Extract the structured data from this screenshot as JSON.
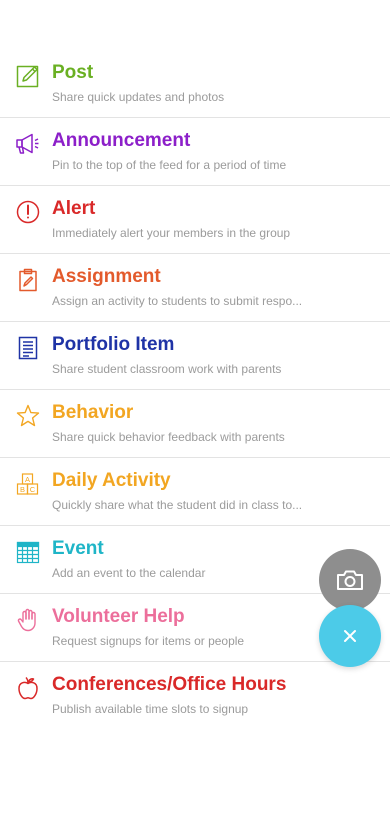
{
  "menu": {
    "items": [
      {
        "title": "Post",
        "subtitle": "Share quick updates and photos",
        "icon": "pencil-square-icon",
        "color": "#6ab023"
      },
      {
        "title": "Announcement",
        "subtitle": "Pin to the top of the feed for a period of time",
        "icon": "megaphone-icon",
        "color": "#8c1fc9"
      },
      {
        "title": "Alert",
        "subtitle": "Immediately alert your members in the group",
        "icon": "exclamation-circle-icon",
        "color": "#d92929"
      },
      {
        "title": "Assignment",
        "subtitle": "Assign an activity to students to submit respo...",
        "icon": "clipboard-icon",
        "color": "#e35a2c"
      },
      {
        "title": "Portfolio Item",
        "subtitle": "Share student classroom work with parents",
        "icon": "document-icon",
        "color": "#1f33a6"
      },
      {
        "title": "Behavior",
        "subtitle": "Share quick behavior feedback with parents",
        "icon": "star-icon",
        "color": "#f2a622"
      },
      {
        "title": "Daily Activity",
        "subtitle": "Quickly share what the student did in class to...",
        "icon": "abc-blocks-icon",
        "color": "#f2a622"
      },
      {
        "title": "Event",
        "subtitle": "Add an event to the calendar",
        "icon": "calendar-icon",
        "color": "#1fb5c7"
      },
      {
        "title": "Volunteer Help",
        "subtitle": "Request signups for items or people",
        "icon": "raised-hand-icon",
        "color": "#ec6f9b"
      },
      {
        "title": "Conferences/Office Hours",
        "subtitle": "Publish available time slots to signup",
        "icon": "apple-icon",
        "color": "#d92929"
      }
    ]
  },
  "fab": {
    "camera_icon": "camera-icon",
    "close_icon": "close-icon",
    "camera_color": "#8e8e8e",
    "close_color": "#4ccbe8"
  }
}
